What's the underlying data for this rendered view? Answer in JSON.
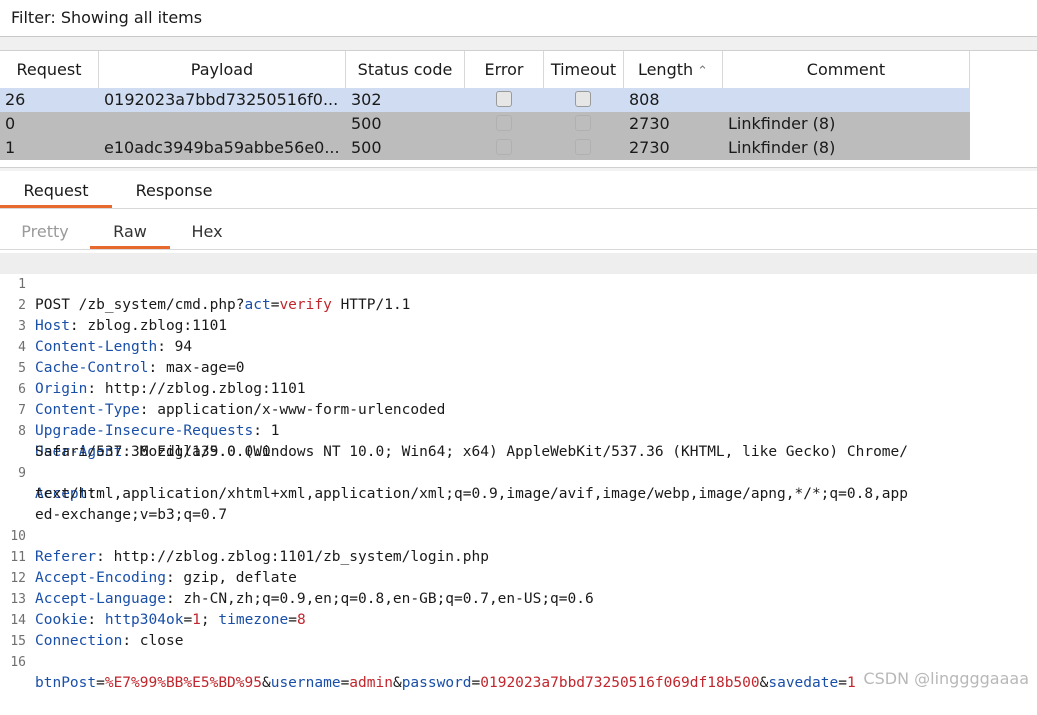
{
  "filter": {
    "text": "Filter: Showing all items"
  },
  "table": {
    "headers": {
      "request": "Request",
      "payload": "Payload",
      "status": "Status code",
      "error": "Error",
      "timeout": "Timeout",
      "length": "Length",
      "comment": "Comment"
    },
    "sort_indicator": "^",
    "rows": [
      {
        "request": "26",
        "payload": "0192023a7bbd73250516f0...",
        "status": "302",
        "length": "808",
        "comment": ""
      },
      {
        "request": "0",
        "payload": "",
        "status": "500",
        "length": "2730",
        "comment": "Linkfinder (8)"
      },
      {
        "request": "1",
        "payload": "e10adc3949ba59abbe56e0...",
        "status": "500",
        "length": "2730",
        "comment": "Linkfinder (8)"
      }
    ]
  },
  "tabs": {
    "request": "Request",
    "response": "Response"
  },
  "subtabs": {
    "pretty": "Pretty",
    "raw": "Raw",
    "hex": "Hex"
  },
  "lines": {
    "n1": "1",
    "n2": "2",
    "n3": "3",
    "n4": "4",
    "n5": "5",
    "n6": "6",
    "n7": "7",
    "n8": "8",
    "n9": "9",
    "n10": "10",
    "n11": "11",
    "n12": "12",
    "n13": "13",
    "n14": "14",
    "n15": "15",
    "n16": "16",
    "l1a": "POST /zb_system/cmd.php?",
    "l1b": "act",
    "l1c": "=",
    "l1d": "verify",
    "l1e": " HTTP/1.1",
    "l2k": "Host",
    "l2v": ": zblog.zblog:1101",
    "l3k": "Content-Length",
    "l3v": ": 94",
    "l4k": "Cache-Control",
    "l4v": ": max-age=0",
    "l5k": "Origin",
    "l5v": ": http://zblog.zblog:1101",
    "l6k": "Content-Type",
    "l6v": ": application/x-www-form-urlencoded",
    "l7k": "Upgrade-Insecure-Requests",
    "l7v": ": 1",
    "l8k": "User-Agent",
    "l8v": ": Mozilla/5.0 (Windows NT 10.0; Win64; x64) AppleWebKit/537.36 (KHTML, like Gecko) Chrome/",
    "l8w": "Safari/537.36 Edg/139.0.0.0",
    "l9k": "Accept",
    "l9v": ":",
    "l9w": "text/html,application/xhtml+xml,application/xml;q=0.9,image/avif,image/webp,image/apng,*/*;q=0.8,app",
    "l9x": "ed-exchange;v=b3;q=0.7",
    "l10k": "Referer",
    "l10v": ": http://zblog.zblog:1101/zb_system/login.php",
    "l11k": "Accept-Encoding",
    "l11v": ": gzip, deflate",
    "l12k": "Accept-Language",
    "l12v": ": zh-CN,zh;q=0.9,en;q=0.8,en-GB;q=0.7,en-US;q=0.6",
    "l13k": "Cookie",
    "l13a": ": ",
    "l13b": "http304ok",
    "l13c": "=",
    "l13d": "1",
    "l13e": "; ",
    "l13f": "timezone",
    "l13g": "=",
    "l13h": "8",
    "l14k": "Connection",
    "l14v": ": close",
    "l16a": "btnPost",
    "l16b": "=",
    "l16c": "%E7%99%BB%E5%BD%95",
    "l16d": "&",
    "l16e": "username",
    "l16f": "=",
    "l16g": "admin",
    "l16h": "&",
    "l16i": "password",
    "l16j": "=",
    "l16k": "0192023a7bbd73250516f069df18b500",
    "l16l": "&",
    "l16m": "savedate",
    "l16n": "=",
    "l16o": "1"
  },
  "watermark": "CSDN @linggggaaaa"
}
